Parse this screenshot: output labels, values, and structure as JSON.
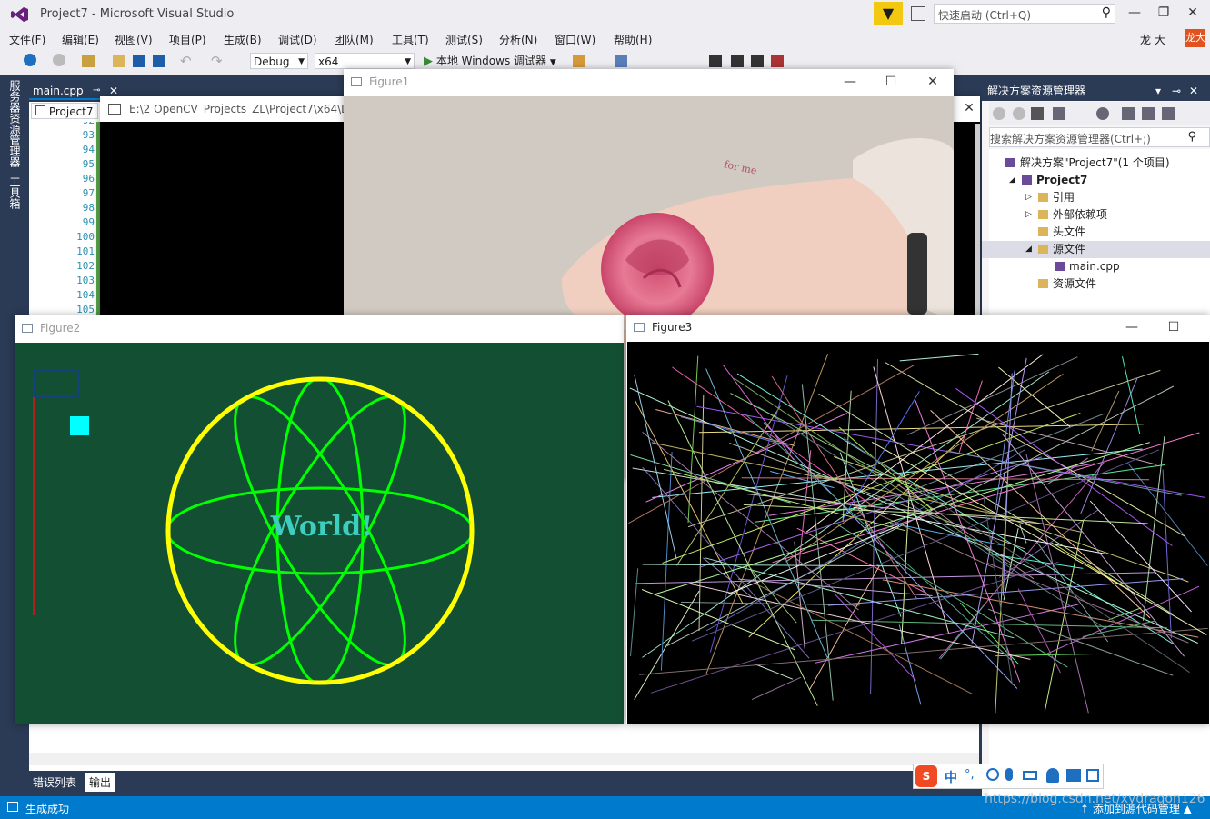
{
  "app": {
    "title": "Project7 - Microsoft Visual Studio",
    "quick_launch_placeholder": "快速启动 (Ctrl+Q)",
    "user": "龙 大",
    "user_badge": "龙大"
  },
  "menu": [
    "文件(F)",
    "编辑(E)",
    "视图(V)",
    "项目(P)",
    "生成(B)",
    "调试(D)",
    "团队(M)",
    "工具(T)",
    "测试(S)",
    "分析(N)",
    "窗口(W)",
    "帮助(H)"
  ],
  "toolbar": {
    "config": "Debug",
    "platform": "x64",
    "run_label": "本地 Windows 调试器"
  },
  "side_tabs": [
    "服务器资源管理器",
    "工具箱"
  ],
  "editor": {
    "tab_main": "main.cpp",
    "project_tab": "Project7",
    "console_path": "E:\\2 OpenCV_Projects_ZL\\Project7\\x64\\De",
    "line_numbers": [
      "92",
      "93",
      "94",
      "95",
      "96",
      "97",
      "98",
      "99",
      "100",
      "101",
      "102",
      "103",
      "104",
      "105"
    ]
  },
  "bottom_tabs": [
    "错误列表",
    "输出"
  ],
  "status": {
    "text": "生成成功",
    "right": "↑ 添加到源代码管理 ▲",
    "watermark": "https://blog.csdn.net/xydragon126"
  },
  "solution_explorer": {
    "title": "解决方案资源管理器",
    "search_placeholder": "搜索解决方案资源管理器(Ctrl+;)",
    "items": [
      {
        "label": "解决方案\"Project7\"(1 个项目)",
        "indent": 0,
        "bold": false
      },
      {
        "label": "Project7",
        "indent": 1,
        "bold": true
      },
      {
        "label": "引用",
        "indent": 2,
        "bold": false
      },
      {
        "label": "外部依赖项",
        "indent": 2,
        "bold": false
      },
      {
        "label": "头文件",
        "indent": 2,
        "bold": false
      },
      {
        "label": "源文件",
        "indent": 2,
        "bold": false,
        "selected": true
      },
      {
        "label": "main.cpp",
        "indent": 3,
        "bold": false
      },
      {
        "label": "资源文件",
        "indent": 2,
        "bold": false
      }
    ]
  },
  "figures": {
    "figure1": {
      "title": "Figure1",
      "annotation": "for me"
    },
    "figure2": {
      "title": "Figure2",
      "text": "World!"
    },
    "figure3": {
      "title": "Figure3"
    }
  },
  "ime_bar": {
    "labels": [
      "中",
      "°,"
    ]
  },
  "colors": {
    "accent": "#007acc",
    "vs_frame": "#2b3a55",
    "figure2_bg": "#134f33",
    "ellipse": "#00ff00",
    "circle": "#ffff00",
    "world_text": "#3ecec0",
    "cyan_square": "#00ffff"
  }
}
